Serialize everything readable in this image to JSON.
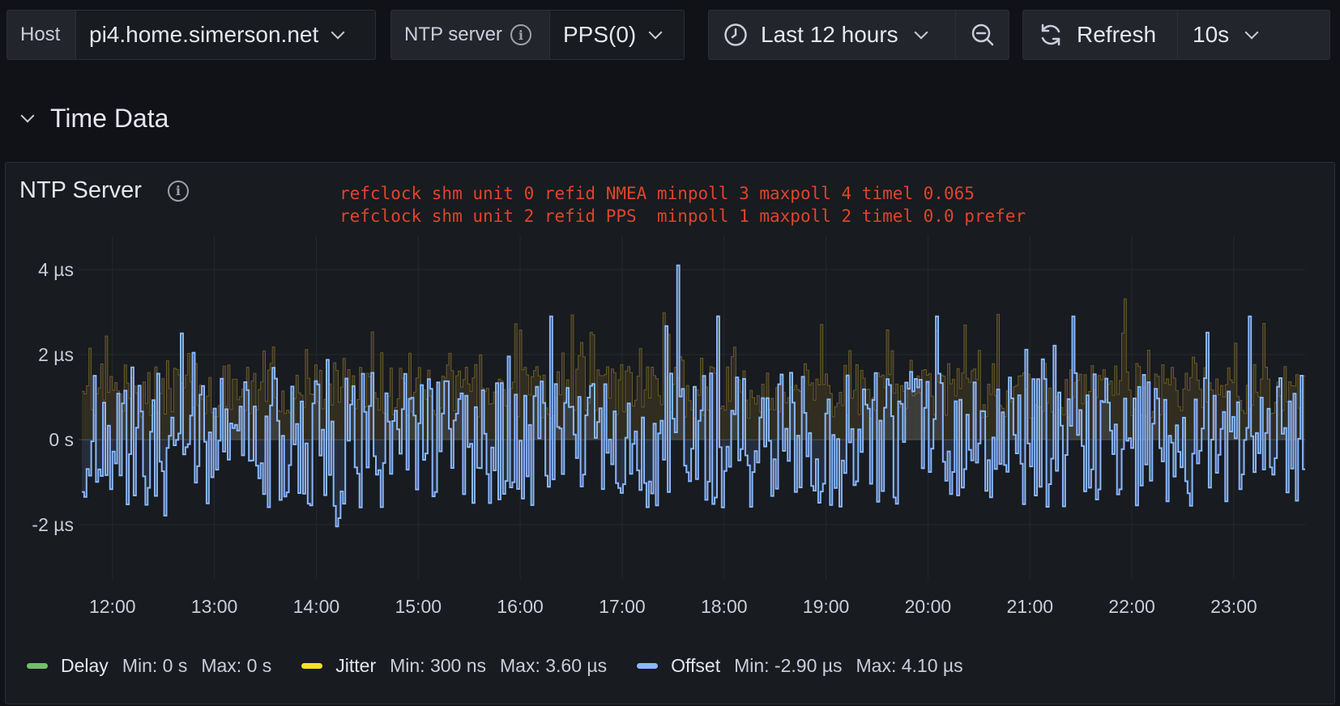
{
  "toolbar": {
    "host_label": "Host",
    "host_value": "pi4.home.simerson.net",
    "ntp_label": "NTP server",
    "ntp_value": "PPS(0)",
    "time_range": "Last 12 hours",
    "refresh_label": "Refresh",
    "refresh_interval": "10s"
  },
  "row": {
    "title": "Time Data"
  },
  "panel": {
    "title": "NTP Server",
    "description_line1": "refclock shm unit 0 refid NMEA minpoll 3 maxpoll 4 timel 0.065",
    "description_line2": "refclock shm unit 2 refid PPS  minpoll 1 maxpoll 2 timel 0.0 prefer"
  },
  "legend": [
    {
      "name": "Delay",
      "color": "#73bf69",
      "min": "Min: 0 s",
      "max": "Max: 0 s"
    },
    {
      "name": "Jitter",
      "color": "#fade2a",
      "min": "Min: 300 ns",
      "max": "Max: 3.60 µs"
    },
    {
      "name": "Offset",
      "color": "#8ab8ff",
      "min": "Min: -2.90 µs",
      "max": "Max: 4.10 µs"
    }
  ],
  "chart_data": {
    "type": "line",
    "ylabel_ticks": [
      "4 µs",
      "2 µs",
      "0 s",
      "-2 µs"
    ],
    "y_tick_values": [
      4,
      2,
      0,
      -2
    ],
    "xlabel_ticks": [
      "12:00",
      "13:00",
      "14:00",
      "15:00",
      "16:00",
      "17:00",
      "18:00",
      "19:00",
      "20:00",
      "21:00",
      "22:00",
      "23:00"
    ],
    "x_range_hours": [
      11.7,
      23.7
    ],
    "ylim": [
      -3.2,
      4.8
    ],
    "units": "µs",
    "series": [
      {
        "name": "Delay",
        "color": "#73bf69",
        "min": 0,
        "max": 0
      },
      {
        "name": "Jitter",
        "color": "#fade2a",
        "min": 0.3,
        "max": 3.6
      },
      {
        "name": "Offset",
        "color": "#8ab8ff",
        "min": -2.9,
        "max": 4.1,
        "peak_at_hour": 17.55
      }
    ],
    "grid": true
  }
}
